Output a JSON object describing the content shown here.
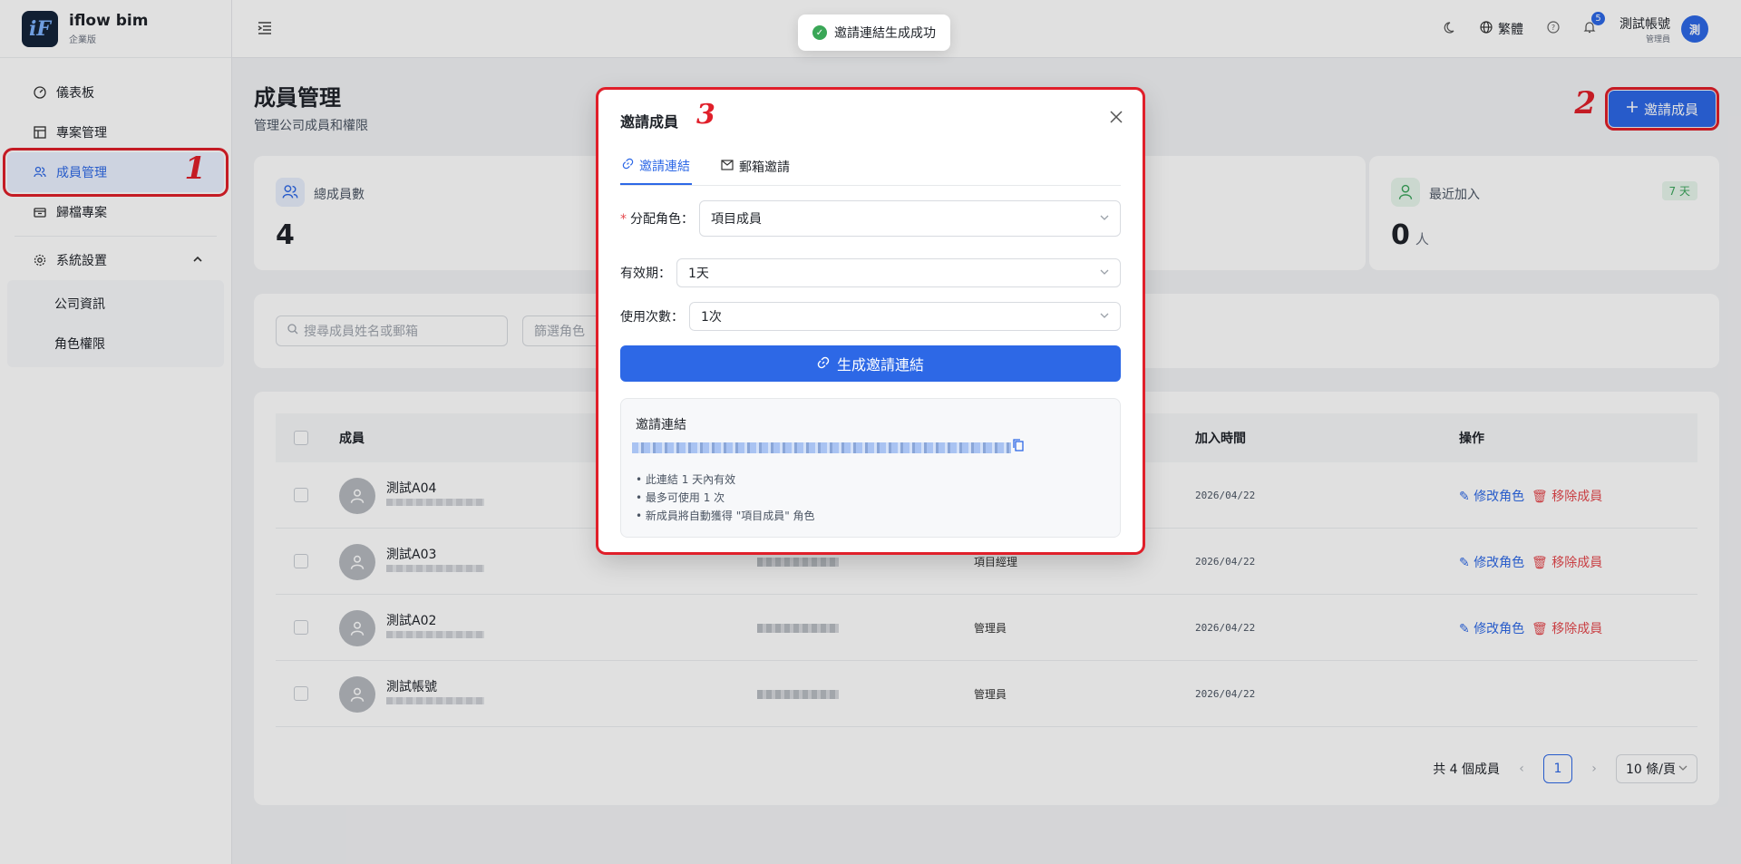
{
  "brand": {
    "name": "iflow bim",
    "edition": "企業版",
    "logo_text": "iF"
  },
  "sidebar": {
    "items": [
      {
        "label": "儀表板",
        "icon": "dashboard-icon"
      },
      {
        "label": "專案管理",
        "icon": "project-icon"
      },
      {
        "label": "成員管理",
        "icon": "members-icon"
      },
      {
        "label": "歸檔專案",
        "icon": "archive-icon"
      },
      {
        "label": "系統設置",
        "icon": "settings-icon"
      }
    ],
    "sub_items": [
      {
        "label": "公司資訊"
      },
      {
        "label": "角色權限"
      }
    ]
  },
  "header": {
    "language": "繁體",
    "notification_count": "5",
    "user_name": "測試帳號",
    "user_role": "管理員",
    "avatar_text": "測"
  },
  "toast": {
    "message": "邀請連結生成成功"
  },
  "page": {
    "title": "成員管理",
    "subtitle": "管理公司成員和權限",
    "invite_button": "邀請成員"
  },
  "annotations": {
    "a1": "1",
    "a2": "2",
    "a3": "3"
  },
  "stats": {
    "total": {
      "label": "總成員數",
      "value": "4"
    },
    "recent": {
      "label": "最近加入",
      "value": "0",
      "unit": "人",
      "tag": "7 天"
    }
  },
  "filters": {
    "search_placeholder": "搜尋成員姓名或郵箱",
    "role_placeholder": "篩選角色"
  },
  "table": {
    "columns": {
      "member": "成員",
      "join_time": "加入時間",
      "ops": "操作"
    },
    "rows": [
      {
        "name": "測試A04",
        "role": "",
        "date": "2026/04/22",
        "edit": "修改角色",
        "remove": "移除成員"
      },
      {
        "name": "測試A03",
        "role": "項目經理",
        "date": "2026/04/22",
        "edit": "修改角色",
        "remove": "移除成員"
      },
      {
        "name": "測試A02",
        "role": "管理員",
        "date": "2026/04/22",
        "edit": "修改角色",
        "remove": "移除成員"
      },
      {
        "name": "測試帳號",
        "role": "管理員",
        "date": "2026/04/22",
        "edit": "",
        "remove": ""
      }
    ]
  },
  "pagination": {
    "total_text": "共 4 個成員",
    "current": "1",
    "page_size": "10 條/頁"
  },
  "modal": {
    "title": "邀請成員",
    "tabs": [
      {
        "label": "邀請連結"
      },
      {
        "label": "郵箱邀請"
      }
    ],
    "role_label": "分配角色：",
    "role_value": "項目成員",
    "expiry_label": "有效期：",
    "expiry_value": "1天",
    "uses_label": "使用次數：",
    "uses_value": "1次",
    "generate_button": "生成邀請連結",
    "link_box": {
      "title": "邀請連結",
      "notes": [
        "• 此連結 1 天內有效",
        "• 最多可使用 1 次",
        "• 新成員將自動獲得 \"項目成員\" 角色"
      ]
    }
  },
  "colors": {
    "primary": "#2d68e6",
    "annotation": "#e01f2a",
    "danger": "#e5484d"
  }
}
